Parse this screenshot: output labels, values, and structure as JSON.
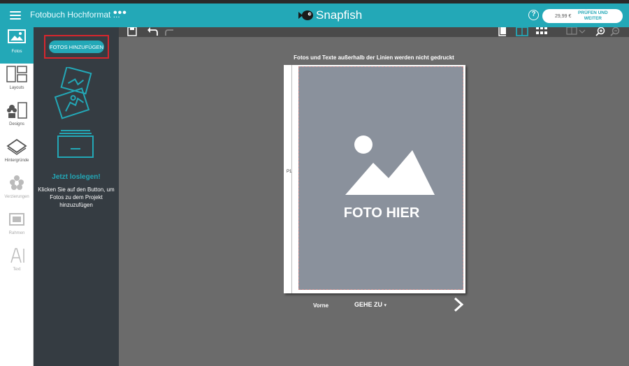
{
  "header": {
    "title": "Fotobuch Hochformat ...",
    "more": "•••",
    "logo": "Snapfish",
    "help": "?",
    "price": "29,99 €",
    "checkout_label": "PRÜFEN UND WEITER"
  },
  "tools": [
    {
      "label": "Fotos",
      "icon": "photo-icon",
      "active": true
    },
    {
      "label": "Layouts",
      "icon": "layouts-icon"
    },
    {
      "label": "Designs",
      "icon": "designs-icon"
    },
    {
      "label": "Hintergründe",
      "icon": "backgrounds-icon"
    },
    {
      "label": "Verzierungen",
      "icon": "embellishments-icon"
    },
    {
      "label": "Rahmen",
      "icon": "frames-icon"
    },
    {
      "label": "Text",
      "icon": "text-icon"
    }
  ],
  "panel": {
    "add_button": "FOTOS HINZUFÜGEN",
    "start_title": "Jetzt loslegen!",
    "start_desc": "Klicken Sie auf den Button, um Fotos zu dem Projekt hinzuzufügen"
  },
  "canvas": {
    "notice": "Fotos und Texte außerhalb der Linien werden nicht gedruckt",
    "placeholder": "FOTO HIER",
    "spine_marker": "P1",
    "page_label": "Vorne",
    "goto_label": "GEHE ZU"
  },
  "colors": {
    "accent": "#23a8b7",
    "panel": "#353c42",
    "highlight": "#d8262d",
    "canvas": "#6b6b6b"
  }
}
